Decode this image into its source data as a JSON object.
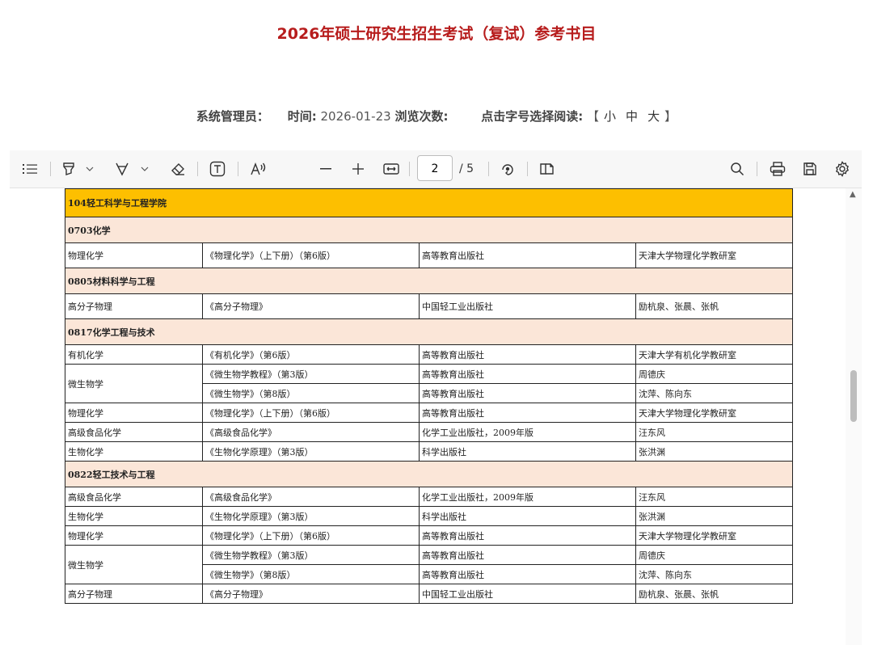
{
  "page": {
    "title": "2026年硕士研究生招生考试（复试）参考书目",
    "meta": {
      "admin_label": "系统管理员：",
      "time_label": "时间:",
      "time_value": "2026-01-23",
      "views_label": "浏览次数:",
      "font_size_label": "点击字号选择阅读:",
      "bracket_open": "【",
      "size_small": "小",
      "size_medium": "中",
      "size_large": "大",
      "bracket_close": "】"
    }
  },
  "toolbar": {
    "page_current": "2",
    "page_total": "/ 5",
    "icons": [
      "contents-icon",
      "highlight-icon",
      "draw-icon",
      "erase-icon",
      "text-box-icon",
      "read-aloud-icon",
      "zoom-out-icon",
      "zoom-in-icon",
      "fit-width-icon",
      "rotate-icon",
      "page-view-icon",
      "search-icon",
      "print-icon",
      "save-icon",
      "settings-icon"
    ]
  },
  "table": {
    "rows": [
      {
        "type": "college",
        "text": "104轻工科学与工程学院"
      },
      {
        "type": "major",
        "text": "0703化学"
      },
      {
        "type": "item",
        "h": "big",
        "course": "物理化学",
        "book": "《物理化学》（上下册）（第6版）",
        "publisher": "高等教育出版社",
        "author": "天津大学物理化学教研室"
      },
      {
        "type": "major",
        "text": "0805材料科学与工程"
      },
      {
        "type": "item",
        "h": "big",
        "course": "高分子物理",
        "book": "《高分子物理》",
        "publisher": "中国轻工业出版社",
        "author": "励杭泉、张晨、张帆"
      },
      {
        "type": "major",
        "text": "0817化学工程与技术"
      },
      {
        "type": "item",
        "h": "small",
        "course": "有机化学",
        "book": "《有机化学》（第6版）",
        "publisher": "高等教育出版社",
        "author": "天津大学有机化学教研室"
      },
      {
        "type": "item",
        "h": "small",
        "course": "微生物学",
        "rowspan": 2,
        "book": "《微生物学教程》（第3版）",
        "publisher": "高等教育出版社",
        "author": "周德庆"
      },
      {
        "type": "item",
        "h": "small",
        "book": "《微生物学》（第8版）",
        "publisher": "高等教育出版社",
        "author": "沈萍、陈向东"
      },
      {
        "type": "item",
        "h": "small",
        "course": "物理化学",
        "book": "《物理化学》（上下册）（第6版）",
        "publisher": "高等教育出版社",
        "author": "天津大学物理化学教研室"
      },
      {
        "type": "item",
        "h": "small",
        "course": "高级食品化学",
        "book": "《高级食品化学》",
        "publisher": "化学工业出版社，2009年版",
        "author": "汪东风"
      },
      {
        "type": "item",
        "h": "small",
        "course": "生物化学",
        "book": "《生物化学原理》（第3版）",
        "publisher": "科学出版社",
        "author": "张洪渊"
      },
      {
        "type": "major",
        "text": "0822轻工技术与工程"
      },
      {
        "type": "item",
        "h": "small",
        "course": "高级食品化学",
        "book": "《高级食品化学》",
        "publisher": "化学工业出版社，2009年版",
        "author": "汪东风"
      },
      {
        "type": "item",
        "h": "small",
        "course": "生物化学",
        "book": "《生物化学原理》（第3版）",
        "publisher": "科学出版社",
        "author": "张洪渊"
      },
      {
        "type": "item",
        "h": "small",
        "course": "物理化学",
        "book": "《物理化学》（上下册）（第6版）",
        "publisher": "高等教育出版社",
        "author": "天津大学物理化学教研室"
      },
      {
        "type": "item",
        "h": "small",
        "course": "微生物学",
        "rowspan": 2,
        "book": "《微生物学教程》（第3版）",
        "publisher": "高等教育出版社",
        "author": "周德庆"
      },
      {
        "type": "item",
        "h": "small",
        "book": "《微生物学》（第8版）",
        "publisher": "高等教育出版社",
        "author": "沈萍、陈向东"
      },
      {
        "type": "item",
        "h": "small",
        "course": "高分子物理",
        "book": "《高分子物理》",
        "publisher": "中国轻工业出版社",
        "author": "励杭泉、张晨、张帆"
      }
    ]
  }
}
